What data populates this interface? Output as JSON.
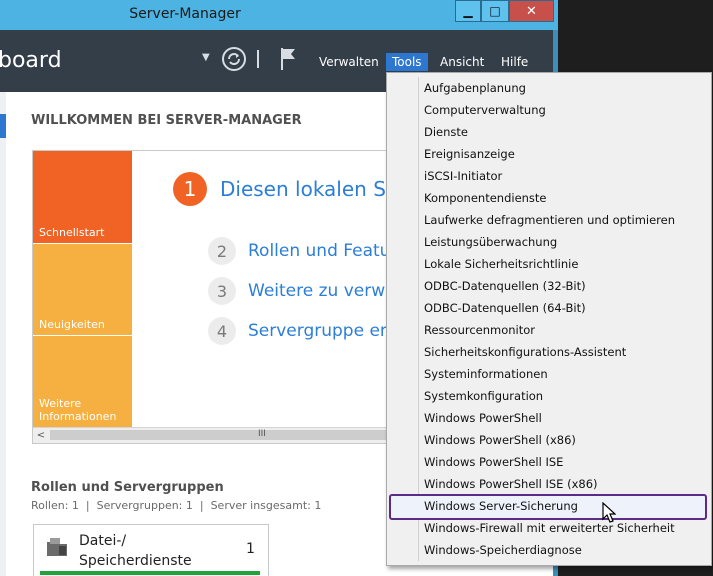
{
  "window": {
    "title": "Server-Manager",
    "controls": {
      "minimize": "▁",
      "maximize": "□",
      "close": "✕"
    }
  },
  "header": {
    "title_fragment": "board",
    "menu": [
      "Verwalten",
      "Tools",
      "Ansicht",
      "Hilfe"
    ],
    "active_menu": "Tools"
  },
  "welcome": {
    "heading": "WILLKOMMEN BEI SERVER-MANAGER",
    "tiles": [
      "Schnellstart",
      "Neuigkeiten",
      "Weitere Informationen"
    ],
    "steps": [
      {
        "num": "1",
        "text": "Diesen lokalen Se"
      },
      {
        "num": "2",
        "text": "Rollen und Feature"
      },
      {
        "num": "3",
        "text": "Weitere zu verwal"
      },
      {
        "num": "4",
        "text": "Servergruppe erst"
      }
    ],
    "scroll_arrow": "<",
    "scroll_grip": "III"
  },
  "roles": {
    "heading": "Rollen und Servergruppen",
    "stats": "Rollen: 1  |  Servergruppen: 1  |  Server insgesamt: 1",
    "card": {
      "name_line1": "Datei-/",
      "name_line2": "Speicherdienste",
      "count": "1"
    }
  },
  "tools_menu": {
    "items": [
      "Aufgabenplanung",
      "Computerverwaltung",
      "Dienste",
      "Ereignisanzeige",
      "iSCSI-Initiator",
      "Komponentendienste",
      "Laufwerke defragmentieren und optimieren",
      "Leistungsüberwachung",
      "Lokale Sicherheitsrichtlinie",
      "ODBC-Datenquellen (32-Bit)",
      "ODBC-Datenquellen (64-Bit)",
      "Ressourcenmonitor",
      "Sicherheitskonfigurations-Assistent",
      "Systeminformationen",
      "Systemkonfiguration",
      "Windows PowerShell",
      "Windows PowerShell (x86)",
      "Windows PowerShell ISE",
      "Windows PowerShell ISE (x86)",
      "Windows Server-Sicherung",
      "Windows-Firewall mit erweiterter Sicherheit",
      "Windows-Speicherdiagnose"
    ],
    "highlighted": "Windows Server-Sicherung"
  },
  "colors": {
    "titlebar": "#4cb3e2",
    "header": "#333e48",
    "accent": "#2e77d0",
    "tile_primary": "#f06325",
    "tile_secondary": "#f6b042",
    "highlight_border": "#5b2b86"
  }
}
